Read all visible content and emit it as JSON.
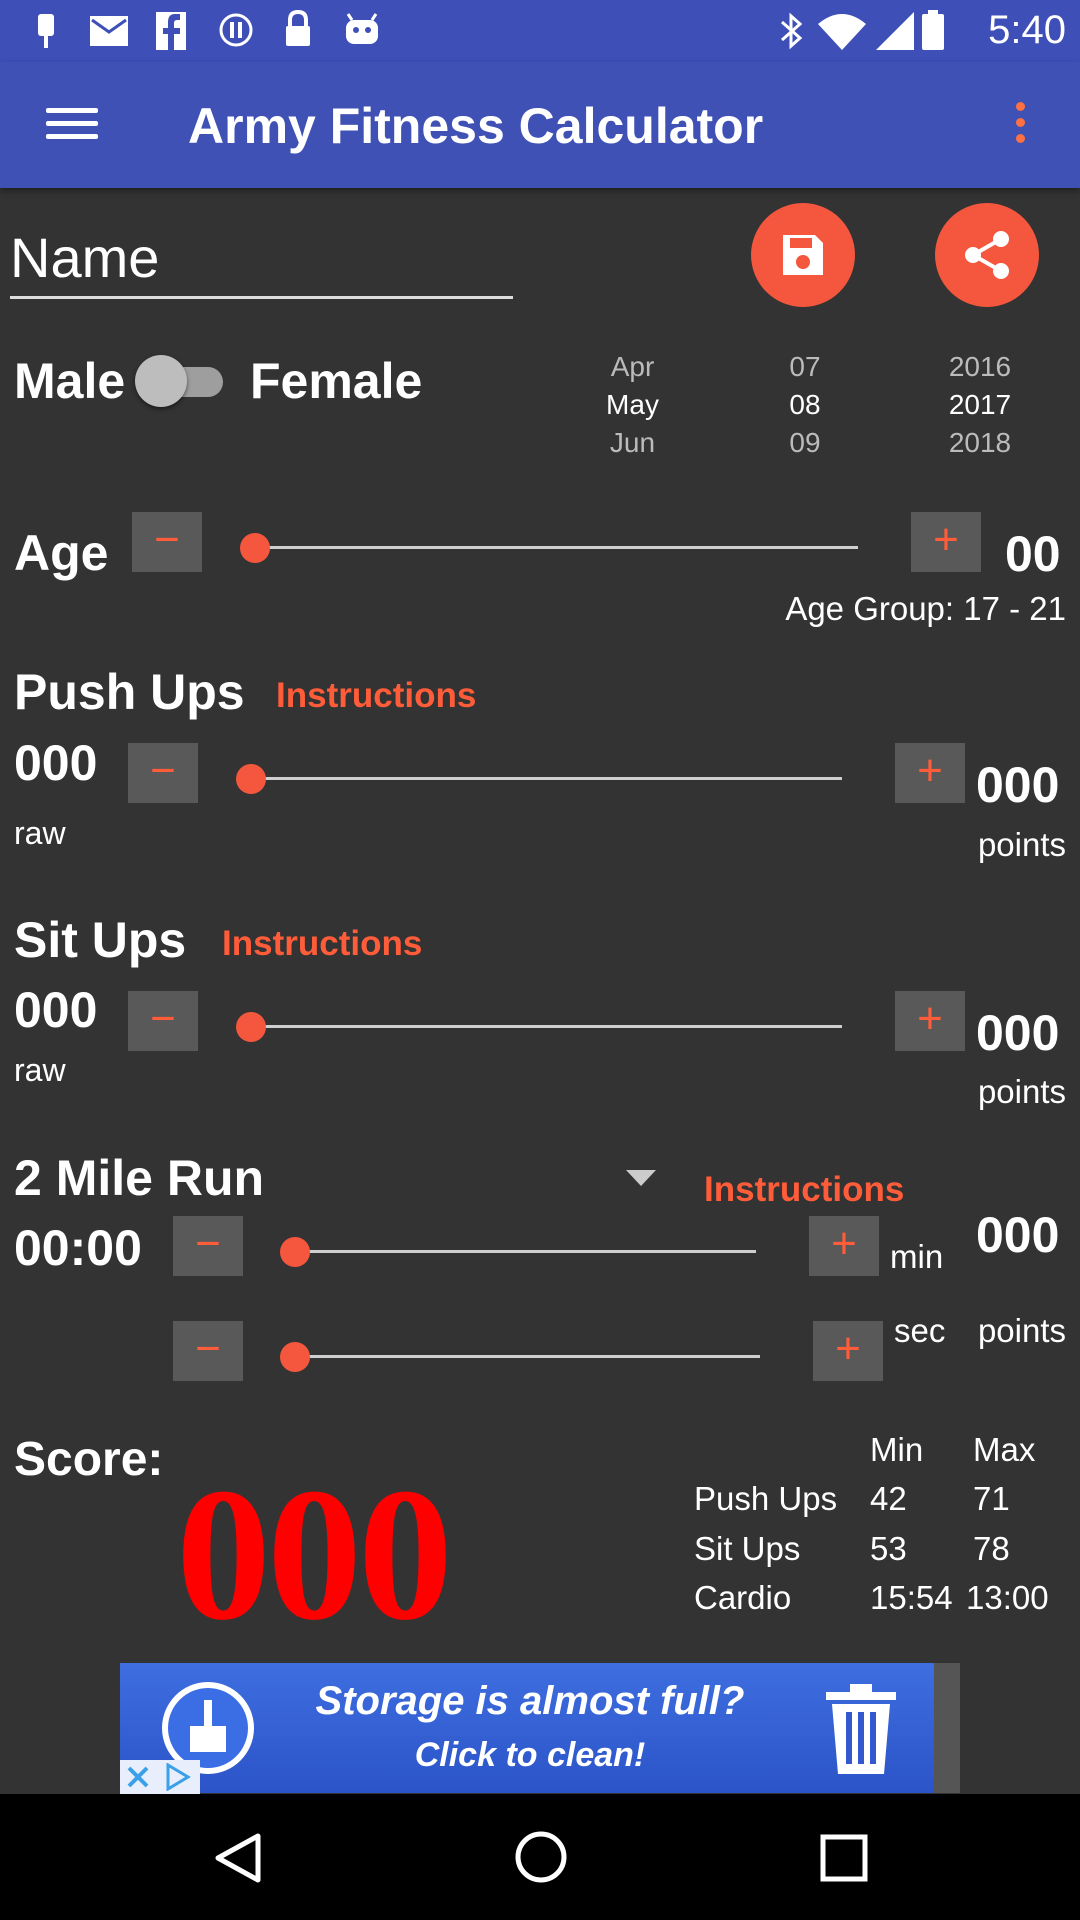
{
  "status_bar": {
    "time": "5:40",
    "left_icons": [
      "notification-icon",
      "mail-icon",
      "facebook-icon",
      "pause-icon",
      "lock-icon",
      "android-icon"
    ],
    "right_icons": [
      "bluetooth-icon",
      "wifi-icon",
      "signal-icon",
      "battery-icon"
    ]
  },
  "app_bar": {
    "title": "Army Fitness Calculator"
  },
  "name": {
    "placeholder": "Name"
  },
  "gender": {
    "male_label": "Male",
    "female_label": "Female",
    "toggle_on": false
  },
  "date_picker": {
    "month": [
      "Apr",
      "May",
      "Jun"
    ],
    "day": [
      "07",
      "08",
      "09"
    ],
    "year": [
      "2016",
      "2017",
      "2018"
    ]
  },
  "age": {
    "label": "Age",
    "value": "00",
    "group_label": "Age Group:  17 - 21",
    "slider_fraction": 0
  },
  "push_ups": {
    "label": "Push Ups",
    "instructions": "Instructions",
    "raw_value": "000",
    "raw_label": "raw",
    "points_value": "000",
    "points_label": "points",
    "slider_fraction": 0
  },
  "sit_ups": {
    "label": "Sit Ups",
    "instructions": "Instructions",
    "raw_value": "000",
    "raw_label": "raw",
    "points_value": "000",
    "points_label": "points",
    "slider_fraction": 0
  },
  "run": {
    "label": "2 Mile Run",
    "instructions": "Instructions",
    "time_value": "00:00",
    "min_label": "min",
    "sec_label": "sec",
    "points_value": "000",
    "points_label": "points",
    "min_slider_fraction": 0,
    "sec_slider_fraction": 0
  },
  "score": {
    "label": "Score:",
    "value": "000"
  },
  "standards": {
    "headers": [
      "Min",
      "Max"
    ],
    "rows": [
      {
        "name": "Push Ups",
        "min": "42",
        "max": "71"
      },
      {
        "name": "Sit Ups",
        "min": "53",
        "max": "78"
      },
      {
        "name": "Cardio",
        "min": "15:54",
        "max": "13:00"
      }
    ]
  },
  "ad": {
    "line1": "Storage is almost full?",
    "line2": "Click to clean!"
  },
  "colors": {
    "app_bar": "#3f51b5",
    "accent": "#f4573d",
    "score": "#ff0000",
    "background": "#333333"
  }
}
